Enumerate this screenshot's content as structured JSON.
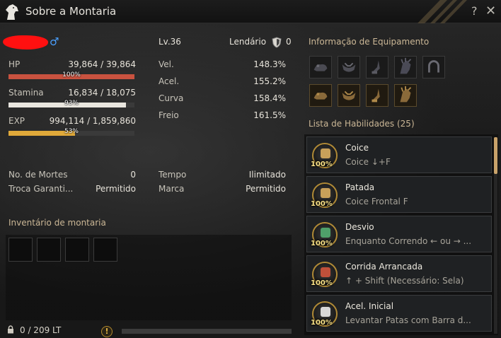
{
  "window": {
    "title": "Sobre a Montaria",
    "help": "?",
    "close": "✕"
  },
  "mount": {
    "gender_symbol": "♂",
    "level": "Lv.36",
    "grade": "Lendário",
    "grade_count": "0"
  },
  "stats": {
    "hp": {
      "label": "HP",
      "value": "39,864 / 39,864",
      "percent_text": "100%",
      "fill": 1.0,
      "color": "#c9523f"
    },
    "stamina": {
      "label": "Stamina",
      "value": "16,834 / 18,075",
      "percent_text": "93%",
      "fill": 0.93,
      "color": "#e9e6df"
    },
    "exp": {
      "label": "EXP",
      "value": "994,114 / 1,859,860",
      "percent_text": "53%",
      "fill": 0.53,
      "color": "#e0a93a"
    }
  },
  "speed_stats": [
    {
      "label": "Vel.",
      "value": "148.3%"
    },
    {
      "label": "Acel.",
      "value": "155.2%"
    },
    {
      "label": "Curva",
      "value": "158.4%"
    },
    {
      "label": "Freio",
      "value": "161.5%"
    }
  ],
  "info": {
    "deaths_label": "No. de Mortes",
    "deaths_value": "0",
    "trade_label": "Troca Garanti...",
    "trade_value": "Permitido",
    "time_label": "Tempo",
    "time_value": "Ilimitado",
    "mark_label": "Marca",
    "mark_value": "Permitido"
  },
  "inventory": {
    "title": "Inventário de montaria",
    "weight": "0 / 209 LT",
    "warn": "!"
  },
  "equipment": {
    "title": "Informação de Equipamento",
    "icons": [
      "barding-icon",
      "saddle-icon",
      "stirrup-icon",
      "champron-icon",
      "horseshoe-icon",
      "barding-outfit-icon",
      "saddle-outfit-icon",
      "stirrup-outfit-icon",
      "champron-outfit-icon"
    ]
  },
  "skills": {
    "title": "Lista de Habilidades (25)",
    "items": [
      {
        "name": "Coice",
        "desc": "Coice ↓+F",
        "pct": "100%",
        "glyph_color": "#c9a15a"
      },
      {
        "name": "Patada",
        "desc": "Coice Frontal F",
        "pct": "100%",
        "glyph_color": "#c9a15a"
      },
      {
        "name": "Desvio",
        "desc": "Enquanto Correndo ← ou → ...",
        "pct": "100%",
        "glyph_color": "#4fa06a"
      },
      {
        "name": "Corrida Arrancada",
        "desc": "↑ + Shift (Necessário: Sela)",
        "pct": "100%",
        "glyph_color": "#c0503a"
      },
      {
        "name": "Acel. Inicial",
        "desc": "Levantar Patas com Barra d...",
        "pct": "100%",
        "glyph_color": "#d8d8d8"
      }
    ]
  }
}
